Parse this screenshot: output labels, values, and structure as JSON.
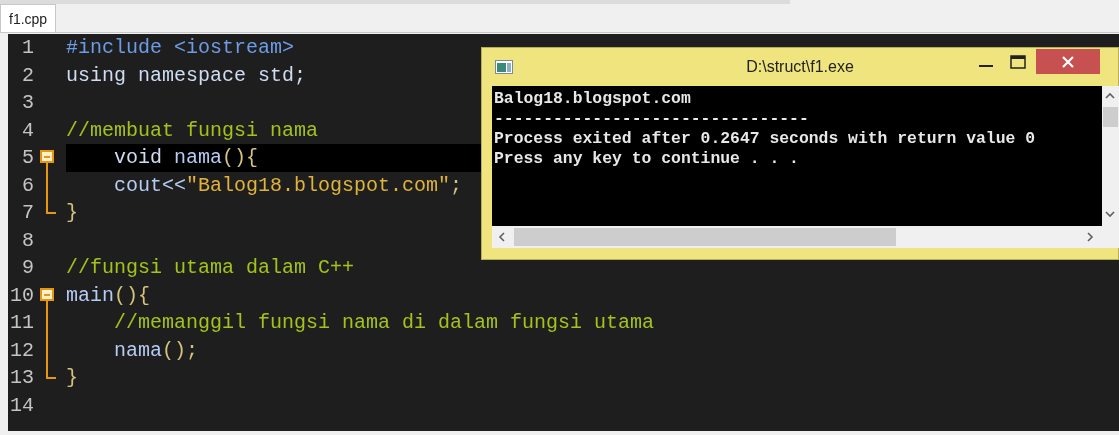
{
  "tab": {
    "label": "f1.cpp",
    "selected": true
  },
  "editor": {
    "lines": [
      {
        "number": "1",
        "kind": "plain",
        "current": false,
        "tokens": [
          {
            "text": "#include <iostream>",
            "kind": "preprocessor"
          }
        ]
      },
      {
        "number": "2",
        "kind": "plain",
        "current": false,
        "tokens": [
          {
            "text": "using namespace std;",
            "kind": "keyword"
          }
        ]
      },
      {
        "number": "3",
        "kind": "plain",
        "current": false
      },
      {
        "number": "4",
        "kind": "plain",
        "current": false,
        "tokens": [
          {
            "text": "//membuat fungsi nama",
            "kind": "comment"
          }
        ]
      },
      {
        "number": "5",
        "kind": "foldstart",
        "current": true,
        "tokens": [
          {
            "text": "    void ",
            "kind": "keyword"
          },
          {
            "text": "nama",
            "kind": "identifier"
          },
          {
            "text": "(){",
            "kind": "punct"
          }
        ]
      },
      {
        "number": "6",
        "kind": "foldbody",
        "current": false,
        "tokens": [
          {
            "text": "    cout<<",
            "kind": "identifier"
          },
          {
            "text": "\"Balog18.blogspot.com\"",
            "kind": "string"
          },
          {
            "text": ";",
            "kind": "punct"
          }
        ]
      },
      {
        "number": "7",
        "kind": "foldend",
        "current": false,
        "tokens": [
          {
            "text": "}",
            "kind": "punct"
          }
        ]
      },
      {
        "number": "8",
        "kind": "plain",
        "current": false
      },
      {
        "number": "9",
        "kind": "plain",
        "current": false,
        "tokens": [
          {
            "text": "//fungsi utama dalam C++",
            "kind": "comment"
          }
        ]
      },
      {
        "number": "10",
        "kind": "foldstart",
        "current": false,
        "tokens": [
          {
            "text": "main",
            "kind": "identifier"
          },
          {
            "text": "(){",
            "kind": "punct"
          }
        ]
      },
      {
        "number": "11",
        "kind": "foldbody",
        "current": false,
        "tokens": [
          {
            "text": "    //memanggil fungsi nama di dalam fungsi utama",
            "kind": "comment"
          }
        ]
      },
      {
        "number": "12",
        "kind": "foldbody",
        "current": false,
        "tokens": [
          {
            "text": "    nama",
            "kind": "identifier"
          },
          {
            "text": "();",
            "kind": "punct"
          }
        ]
      },
      {
        "number": "13",
        "kind": "foldend",
        "current": false,
        "tokens": [
          {
            "text": "}",
            "kind": "punct"
          }
        ]
      },
      {
        "number": "14",
        "kind": "plain",
        "current": false
      }
    ]
  },
  "console": {
    "title": "D:\\struct\\f1.exe",
    "output": [
      "Balog18.blogspot.com",
      "--------------------------------",
      "Process exited after 0.2647 seconds with return value 0",
      "Press any key to continue . . ."
    ]
  }
}
